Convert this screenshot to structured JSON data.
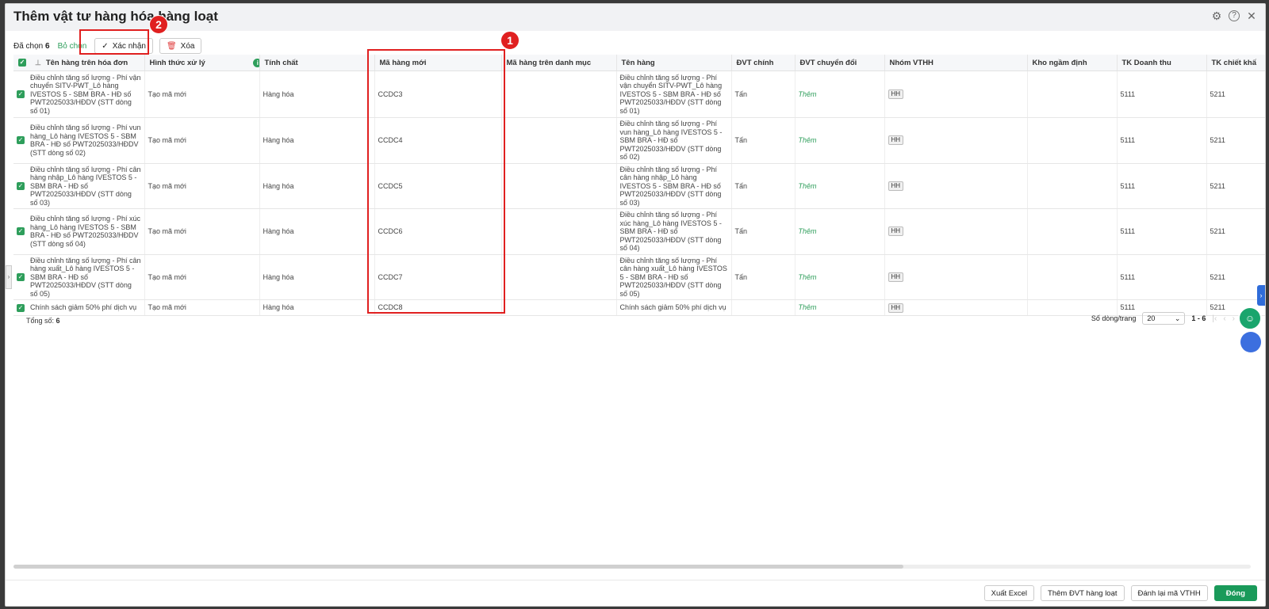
{
  "dialog": {
    "title": "Thêm vật tư hàng hóa hàng loạt"
  },
  "toolbar": {
    "selected_label": "Đã chọn",
    "selected_count": "6",
    "deselect_label": "Bỏ chọn",
    "confirm_label": "Xác nhận",
    "delete_label": "Xóa"
  },
  "annotations": {
    "badge1": "1",
    "badge2": "2"
  },
  "table": {
    "columns": [
      "Tên hàng trên hóa đơn",
      "Hình thức xử lý",
      "Tính chất",
      "Mã hàng mới",
      "Mã hàng trên danh mục",
      "Tên hàng",
      "ĐVT chính",
      "ĐVT chuyển đổi",
      "Nhóm VTHH",
      "Kho ngầm định",
      "TK Doanh thu",
      "TK chiết khấ"
    ],
    "rows": [
      {
        "invoice_name": "Điều chỉnh tăng số lượng - Phí vận chuyển SITV-PWT_Lô hàng IVESTOS 5 - SBM BRA - HĐ số PWT2025033/HĐDV (STT dòng số 01)",
        "method": "Tạo mã mới",
        "nature": "Hàng hóa",
        "new_code": "CCDC3",
        "catalog_code": "",
        "name": "Điều chỉnh tăng số lượng - Phí vận chuyển SITV-PWT_Lô hàng IVESTOS 5 - SBM BRA - HĐ số PWT2025033/HĐDV (STT dòng số 01)",
        "unit": "Tấn",
        "conv_unit": "Thêm",
        "group": "HH",
        "warehouse": "",
        "revenue_acc": "5111",
        "discount_acc": "5211"
      },
      {
        "invoice_name": "Điều chỉnh tăng số lượng - Phí vun hàng_Lô hàng IVESTOS 5 - SBM BRA - HĐ số PWT2025033/HĐDV (STT dòng số 02)",
        "method": "Tạo mã mới",
        "nature": "Hàng hóa",
        "new_code": "CCDC4",
        "catalog_code": "",
        "name": "Điều chỉnh tăng số lượng - Phí vun hàng_Lô hàng IVESTOS 5 - SBM BRA - HĐ số PWT2025033/HĐDV (STT dòng số 02)",
        "unit": "Tấn",
        "conv_unit": "Thêm",
        "group": "HH",
        "warehouse": "",
        "revenue_acc": "5111",
        "discount_acc": "5211"
      },
      {
        "invoice_name": "Điều chỉnh tăng số lượng - Phí cân hàng nhập_Lô hàng IVESTOS 5 - SBM BRA - HĐ số PWT2025033/HĐDV (STT dòng số 03)",
        "method": "Tạo mã mới",
        "nature": "Hàng hóa",
        "new_code": "CCDC5",
        "catalog_code": "",
        "name": "Điều chỉnh tăng số lượng - Phí cân hàng nhập_Lô hàng IVESTOS 5 - SBM BRA - HĐ số PWT2025033/HĐDV (STT dòng số 03)",
        "unit": "Tấn",
        "conv_unit": "Thêm",
        "group": "HH",
        "warehouse": "",
        "revenue_acc": "5111",
        "discount_acc": "5211"
      },
      {
        "invoice_name": "Điều chỉnh tăng số lượng - Phí xúc hàng_Lô hàng IVESTOS 5 - SBM BRA - HĐ số PWT2025033/HĐDV (STT dòng số 04)",
        "method": "Tạo mã mới",
        "nature": "Hàng hóa",
        "new_code": "CCDC6",
        "catalog_code": "",
        "name": "Điều chỉnh tăng số lượng - Phí xúc hàng_Lô hàng IVESTOS 5 - SBM BRA - HĐ số PWT2025033/HĐDV (STT dòng số 04)",
        "unit": "Tấn",
        "conv_unit": "Thêm",
        "group": "HH",
        "warehouse": "",
        "revenue_acc": "5111",
        "discount_acc": "5211"
      },
      {
        "invoice_name": "Điều chỉnh tăng số lượng - Phí cân hàng xuất_Lô hàng IVESTOS 5 - SBM BRA - HĐ số PWT2025033/HĐDV (STT dòng số 05)",
        "method": "Tạo mã mới",
        "nature": "Hàng hóa",
        "new_code": "CCDC7",
        "catalog_code": "",
        "name": "Điều chỉnh tăng số lượng - Phí cân hàng xuất_Lô hàng IVESTOS 5 - SBM BRA - HĐ số PWT2025033/HĐDV (STT dòng số 05)",
        "unit": "Tấn",
        "conv_unit": "Thêm",
        "group": "HH",
        "warehouse": "",
        "revenue_acc": "5111",
        "discount_acc": "5211"
      },
      {
        "invoice_name": "Chính sách giảm 50% phí dịch vụ",
        "method": "Tạo mã mới",
        "nature": "Hàng hóa",
        "new_code": "CCDC8",
        "catalog_code": "",
        "name": "Chính sách giảm 50% phí dịch vụ",
        "unit": "",
        "conv_unit": "Thêm",
        "group": "HH",
        "warehouse": "",
        "revenue_acc": "5111",
        "discount_acc": "5211"
      }
    ]
  },
  "footer": {
    "total_label": "Tổng số:",
    "total_value": "6",
    "rows_per_page_label": "Số dòng/trang",
    "rows_per_page_value": "20",
    "range": "1 - 6"
  },
  "actions": {
    "export_excel": "Xuất Excel",
    "add_units": "Thêm ĐVT hàng loạt",
    "renumber": "Đánh lại mã VTHH",
    "close": "Đóng"
  },
  "icons": [
    "gear-icon",
    "help-icon",
    "close-icon",
    "check-icon",
    "trash-icon",
    "pin-icon",
    "info-icon",
    "chevron-down-icon",
    "chat-icon"
  ],
  "colors": {
    "accent_green": "#2e9e5b",
    "primary_button": "#1a9a5a",
    "annotation_red": "#e02020",
    "side_tab_blue": "#2f6cd9"
  }
}
